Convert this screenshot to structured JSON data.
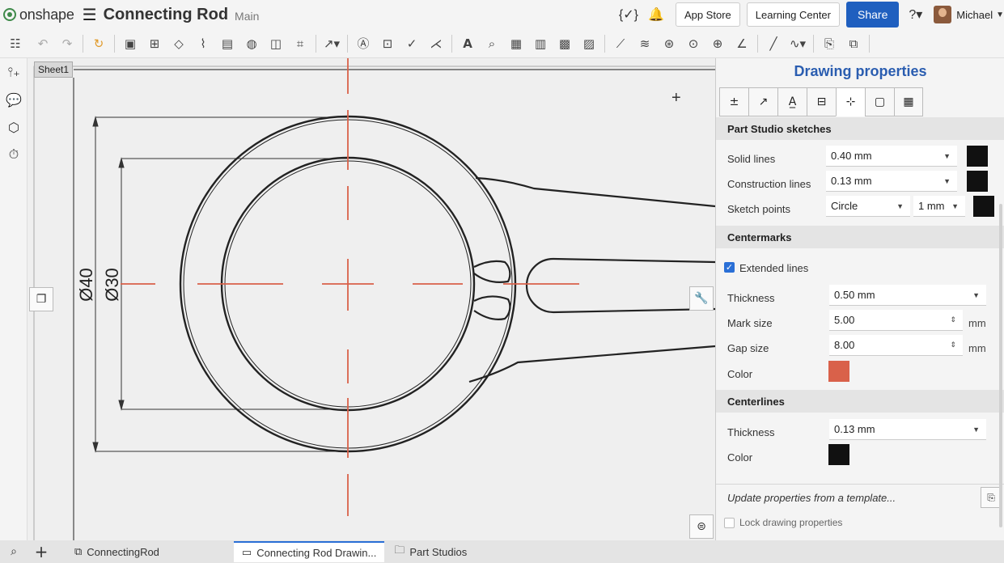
{
  "app": {
    "logo_text": "onshape",
    "doc_title": "Connecting Rod",
    "branch": "Main"
  },
  "topright": {
    "app_store": "App Store",
    "learning_center": "Learning Center",
    "share": "Share",
    "user_name": "Michael"
  },
  "canvas": {
    "sheet_tab": "Sheet1",
    "dim_outer": "Ø40",
    "dim_inner": "Ø30"
  },
  "panel": {
    "title": "Drawing properties",
    "sections": {
      "sketches": "Part Studio sketches",
      "centermarks": "Centermarks",
      "centerlines": "Centerlines"
    },
    "solid_lines": {
      "label": "Solid lines",
      "value": "0.40 mm",
      "color": "#111111"
    },
    "construction_lines": {
      "label": "Construction lines",
      "value": "0.13 mm",
      "color": "#111111"
    },
    "sketch_points": {
      "label": "Sketch points",
      "shape": "Circle",
      "size": "1 mm",
      "color": "#111111"
    },
    "extended_lines": {
      "label": "Extended lines",
      "checked": true
    },
    "cm_thickness": {
      "label": "Thickness",
      "value": "0.50 mm"
    },
    "mark_size": {
      "label": "Mark size",
      "value": "5.00",
      "unit": "mm"
    },
    "gap_size": {
      "label": "Gap size",
      "value": "8.00",
      "unit": "mm"
    },
    "cm_color": {
      "label": "Color",
      "color": "#d9614a"
    },
    "cl_thickness": {
      "label": "Thickness",
      "value": "0.13 mm"
    },
    "cl_color": {
      "label": "Color",
      "color": "#111111"
    },
    "update_template": "Update properties from a template...",
    "lock": {
      "label": "Lock drawing properties",
      "checked": false
    }
  },
  "bottom_tabs": [
    {
      "label": "ConnectingRod",
      "active": false
    },
    {
      "label": "Connecting Rod Drawin...",
      "active": true
    },
    {
      "label": "Part Studios",
      "active": false
    }
  ],
  "colors": {
    "accent": "#2a5db0",
    "share_button": "#1f5fbf",
    "centermark": "#d9614a"
  }
}
